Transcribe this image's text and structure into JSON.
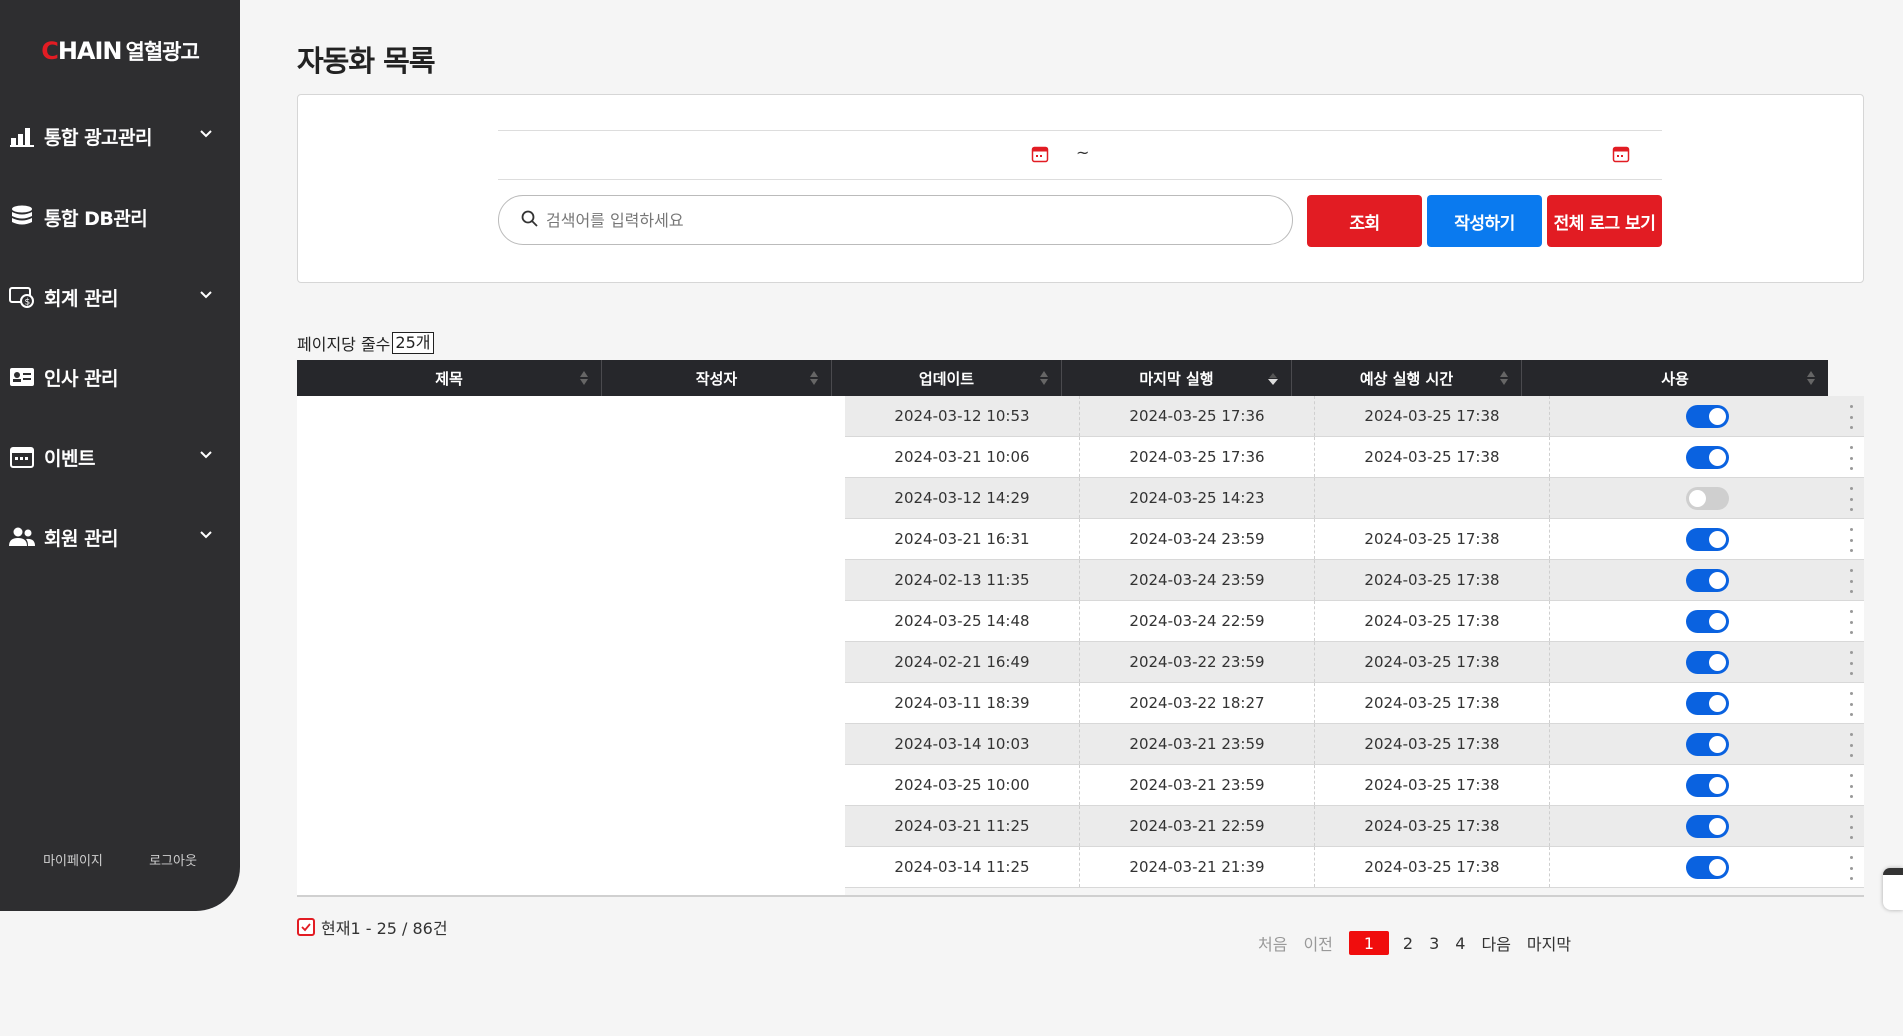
{
  "brand": {
    "logo_c": "C",
    "logo_rest": "HAIN",
    "logo_kor": "열혈광고",
    "accent": "#e21c23"
  },
  "sidebar": {
    "items": [
      {
        "label": "통합 광고관리",
        "icon": "bar-chart-icon",
        "has_submenu": true
      },
      {
        "label": "통합 DB관리",
        "icon": "database-icon",
        "has_submenu": false
      },
      {
        "label": "회계 관리",
        "icon": "money-icon",
        "has_submenu": true
      },
      {
        "label": "인사 관리",
        "icon": "id-card-icon",
        "has_submenu": false
      },
      {
        "label": "이벤트",
        "icon": "calendar-icon",
        "has_submenu": true
      },
      {
        "label": "회원 관리",
        "icon": "users-icon",
        "has_submenu": true
      }
    ],
    "footer": {
      "mypage": "마이페이지",
      "logout": "로그아웃"
    }
  },
  "page": {
    "title": "자동화 목록"
  },
  "filter": {
    "date_separator": "~",
    "search_placeholder": "검색어를 입력하세요",
    "buttons": {
      "search": "조회",
      "create": "작성하기",
      "all_logs": "전체 로그 보기"
    }
  },
  "list": {
    "per_page_label": "페이지당 줄수",
    "per_page_value": "25개",
    "columns": [
      "제목",
      "작성자",
      "업데이트",
      "마지막 실행",
      "예상 실행 시간",
      "사용"
    ],
    "rows": [
      {
        "updated": "2024-03-12 10:53",
        "last_run": "2024-03-25 17:36",
        "next_run": "2024-03-25 17:38",
        "enabled": true
      },
      {
        "updated": "2024-03-21 10:06",
        "last_run": "2024-03-25 17:36",
        "next_run": "2024-03-25 17:38",
        "enabled": true
      },
      {
        "updated": "2024-03-12 14:29",
        "last_run": "2024-03-25 14:23",
        "next_run": "",
        "enabled": false
      },
      {
        "updated": "2024-03-21 16:31",
        "last_run": "2024-03-24 23:59",
        "next_run": "2024-03-25 17:38",
        "enabled": true
      },
      {
        "updated": "2024-02-13 11:35",
        "last_run": "2024-03-24 23:59",
        "next_run": "2024-03-25 17:38",
        "enabled": true
      },
      {
        "updated": "2024-03-25 14:48",
        "last_run": "2024-03-24 22:59",
        "next_run": "2024-03-25 17:38",
        "enabled": true
      },
      {
        "updated": "2024-02-21 16:49",
        "last_run": "2024-03-22 23:59",
        "next_run": "2024-03-25 17:38",
        "enabled": true
      },
      {
        "updated": "2024-03-11 18:39",
        "last_run": "2024-03-22 18:27",
        "next_run": "2024-03-25 17:38",
        "enabled": true
      },
      {
        "updated": "2024-03-14 10:03",
        "last_run": "2024-03-21 23:59",
        "next_run": "2024-03-25 17:38",
        "enabled": true
      },
      {
        "updated": "2024-03-25 10:00",
        "last_run": "2024-03-21 23:59",
        "next_run": "2024-03-25 17:38",
        "enabled": true
      },
      {
        "updated": "2024-03-21 11:25",
        "last_run": "2024-03-21 22:59",
        "next_run": "2024-03-25 17:38",
        "enabled": true
      },
      {
        "updated": "2024-03-14 11:25",
        "last_run": "2024-03-21 21:39",
        "next_run": "2024-03-25 17:38",
        "enabled": true
      }
    ],
    "summary": "현재1 - 25 / 86건"
  },
  "pagination": {
    "first": "처음",
    "prev": "이전",
    "pages": [
      "1",
      "2",
      "3",
      "4"
    ],
    "current": "1",
    "next": "다음",
    "last": "마지막"
  }
}
